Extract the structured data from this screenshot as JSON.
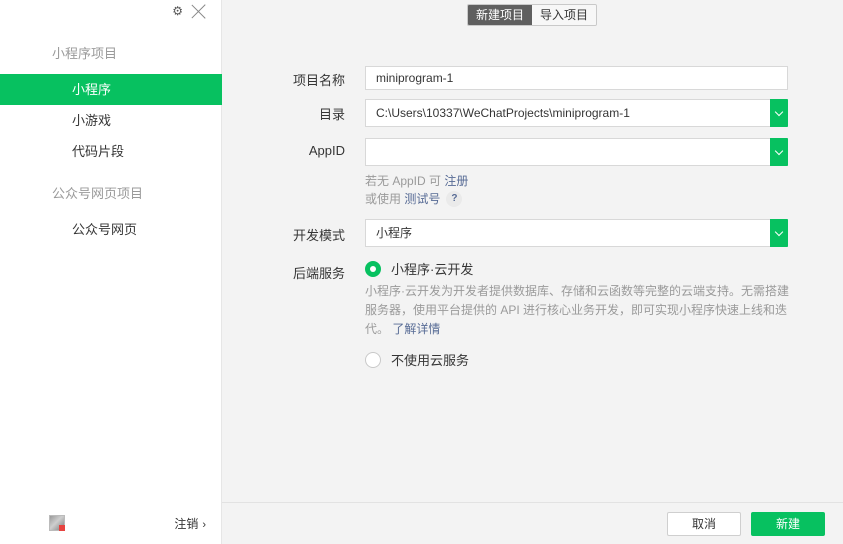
{
  "sidebar": {
    "sections": [
      {
        "title": "小程序项目",
        "items": [
          {
            "label": "小程序",
            "active": true
          },
          {
            "label": "小游戏",
            "active": false
          },
          {
            "label": "代码片段",
            "active": false
          }
        ]
      },
      {
        "title": "公众号网页项目",
        "items": [
          {
            "label": "公众号网页",
            "active": false
          }
        ]
      }
    ],
    "footer": {
      "logout_label": "注销",
      "logout_chevron": "›"
    }
  },
  "header": {
    "tabs": [
      {
        "label": "新建项目",
        "active": true
      },
      {
        "label": "导入项目",
        "active": false
      }
    ]
  },
  "form": {
    "project_name": {
      "label": "项目名称",
      "value": "miniprogram-1"
    },
    "directory": {
      "label": "目录",
      "value": "C:\\Users\\10337\\WeChatProjects\\miniprogram-1"
    },
    "appid": {
      "label": "AppID",
      "value": "",
      "hint_no_appid": "若无 AppID 可",
      "hint_register_link": "注册",
      "hint_or_use": "或使用",
      "hint_test_link": "测试号",
      "help_glyph": "?"
    },
    "dev_mode": {
      "label": "开发模式",
      "value": "小程序"
    },
    "backend": {
      "label": "后端服务",
      "options": [
        {
          "label": "小程序·云开发",
          "checked": true
        },
        {
          "label": "不使用云服务",
          "checked": false
        }
      ],
      "description": "小程序·云开发为开发者提供数据库、存储和云函数等完整的云端支持。无需搭建服务器，使用平台提供的 API 进行核心业务开发，即可实现小程序快速上线和迭代。",
      "learn_more": "了解详情"
    }
  },
  "footer": {
    "cancel_label": "取消",
    "create_label": "新建"
  },
  "colors": {
    "accent": "#07c160",
    "link": "#576b95",
    "tab_active": "#5f5f5f"
  },
  "icons": {
    "settings": "gear-icon",
    "close": "close-icon"
  }
}
